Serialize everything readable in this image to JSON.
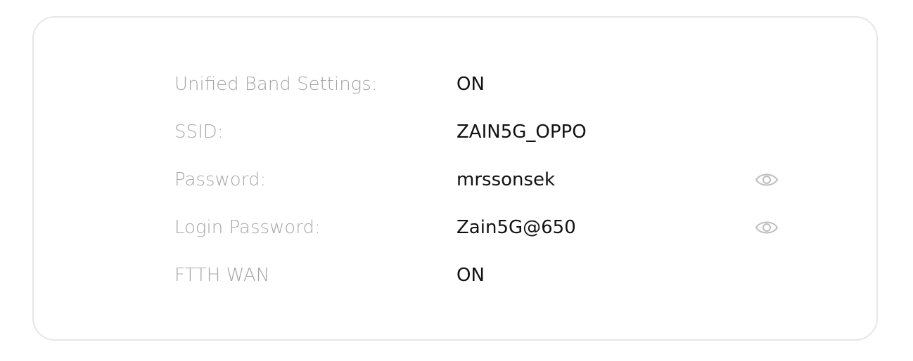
{
  "settings": {
    "rows": [
      {
        "label": "Unified Band Settings:",
        "value": "ON"
      },
      {
        "label": "SSID:",
        "value": "ZAIN5G_OPPO"
      },
      {
        "label": "Password:",
        "value": "mrssonsek",
        "icon": "eye-icon"
      },
      {
        "label": "Login Password:",
        "value": "Zain5G@650",
        "icon": "eye-icon"
      },
      {
        "label": "FTTH WAN",
        "value": "ON"
      }
    ]
  },
  "colors": {
    "label": "#a6a6a6",
    "value": "#111111",
    "border": "#e6e6e6",
    "icon": "#bdbdbd"
  }
}
